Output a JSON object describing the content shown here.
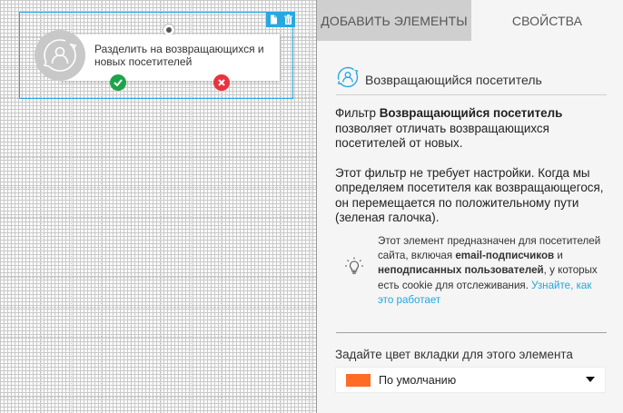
{
  "canvas": {
    "node": {
      "label": "Разделить на возвращающихся и новых посетителей",
      "icon": "returning-visitor-icon"
    }
  },
  "tabs": {
    "add_elements": "ДОБАВИТЬ ЭЛЕМЕНТЫ",
    "properties": "СВОЙСТВА"
  },
  "properties": {
    "title": "Возвращающийся посетитель",
    "desc1_pre": "Фильтр ",
    "desc1_bold": "Возвращающийся посетитель",
    "desc1_post": " позволяет отличать возвращающихся посетителей от новых.",
    "desc2": "Этот фильтр не требует настройки. Когда мы определяем посетителя как возвращающегося, он перемещается по положительному пути (зеленая галочка).",
    "tip": {
      "p1": "Этот элемент предназначен для посетителей сайта, включая ",
      "b1": "email-подписчиков",
      "p2": " и ",
      "b2": "неподписанных пользователей",
      "p3": ", у которых есть cookie для отслеживания. ",
      "link": "Узнайте, как это работает"
    },
    "color_label": "Задайте цвет вкладки для этого элемента",
    "color_value": "По умолчанию"
  },
  "colors": {
    "accent": "#29a8e0",
    "yes": "#1ea34a",
    "no": "#e8333f",
    "swatch": "#ff6c26"
  }
}
